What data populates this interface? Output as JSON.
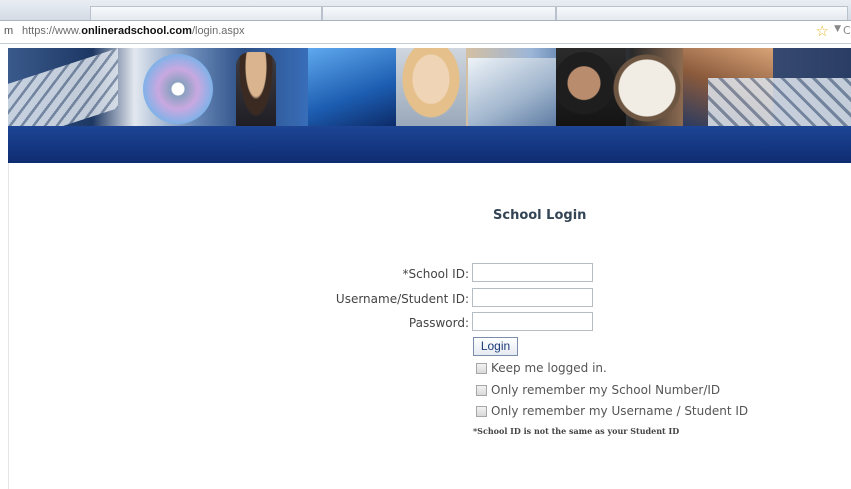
{
  "browser": {
    "url_prefix": "m",
    "url_scheme": "https://www.",
    "url_domain": "onlineradschool.com",
    "url_path": "/login.aspx",
    "icons": {
      "bookmark": "star-icon",
      "dropdown": "dropdown-icon",
      "reload": "reload-icon"
    }
  },
  "page": {
    "title": "School Login",
    "fields": {
      "school_id_label": "*School ID:",
      "username_label": "Username/Student ID:",
      "password_label": "Password:",
      "school_id_value": "",
      "username_value": "",
      "password_value": ""
    },
    "login_button": "Login",
    "options": {
      "keep_logged_in": "Keep me logged in.",
      "remember_school": "Only remember my School Number/ID",
      "remember_username": "Only remember my Username / Student ID"
    },
    "note": "*School ID is not the same as your Student ID"
  },
  "colors": {
    "header_bar": "#163a86",
    "button_text": "#1d3c78",
    "star": "#e8b630"
  }
}
